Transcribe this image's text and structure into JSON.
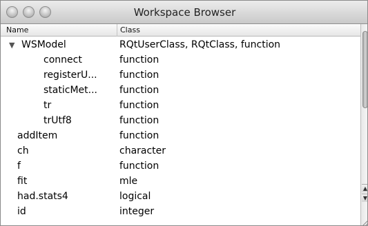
{
  "window": {
    "title": "Workspace Browser"
  },
  "header": {
    "name_label": "Name",
    "class_label": "Class"
  },
  "rows": [
    {
      "name": "WSModel",
      "class": "RQtUserClass, RQtClass, function",
      "expanded": true,
      "depth": 0
    },
    {
      "name": "connect",
      "class": "function",
      "depth": 1
    },
    {
      "name": "registerU...",
      "class": "function",
      "depth": 1
    },
    {
      "name": "staticMet...",
      "class": "function",
      "depth": 1
    },
    {
      "name": "tr",
      "class": "function",
      "depth": 1
    },
    {
      "name": "trUtf8",
      "class": "function",
      "depth": 1
    },
    {
      "name": "addItem",
      "class": "function",
      "depth": 0
    },
    {
      "name": "ch",
      "class": "character",
      "depth": 0
    },
    {
      "name": "f",
      "class": "function",
      "depth": 0
    },
    {
      "name": "fit",
      "class": "mle",
      "depth": 0
    },
    {
      "name": "had.stats4",
      "class": "logical",
      "depth": 0
    },
    {
      "name": "id",
      "class": "integer",
      "depth": 0
    }
  ],
  "icons": {
    "expand": "disclosure-triangle-down",
    "scroll_up": "scroll-up-arrow",
    "scroll_down": "scroll-down-arrow"
  }
}
